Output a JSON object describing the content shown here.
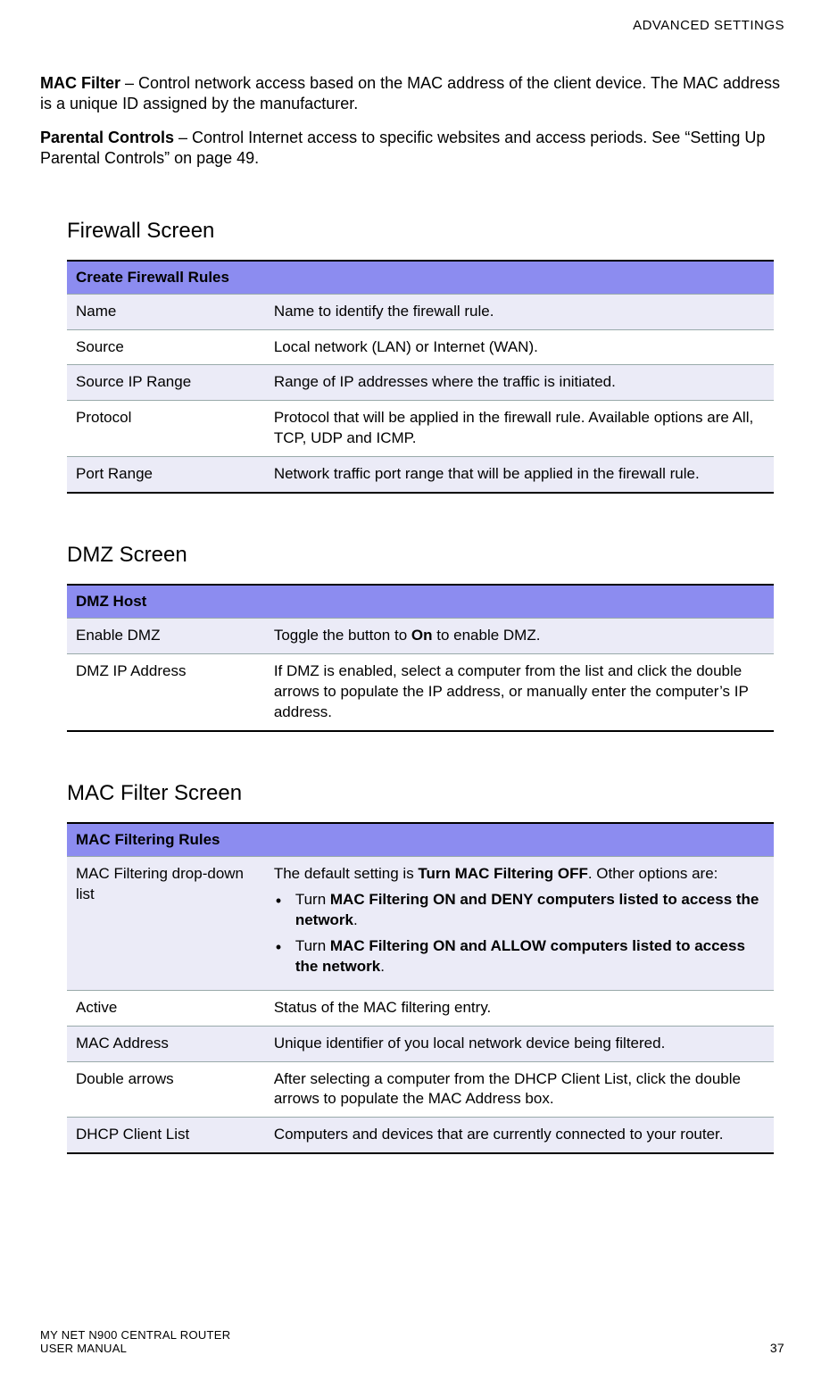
{
  "header": {
    "section": "ADVANCED SETTINGS"
  },
  "intro": {
    "macFilter": {
      "term": "MAC Filter",
      "desc": " – Control network access based on the MAC address of the client device. The MAC address is a unique ID assigned by the manufacturer."
    },
    "parental": {
      "term": "Parental Controls",
      "desc": " – Control Internet access to specific websites and access periods. See “Setting Up Parental Controls” on page 49."
    }
  },
  "firewall": {
    "title": "Firewall Screen",
    "tableHeader": "Create Firewall Rules",
    "rows": [
      {
        "label": "Name",
        "desc": "Name to identify the firewall rule."
      },
      {
        "label": "Source",
        "desc": "Local network (LAN) or Internet (WAN)."
      },
      {
        "label": "Source IP Range",
        "desc": "Range of IP addresses where the traffic is initiated."
      },
      {
        "label": "Protocol",
        "desc": "Protocol that will be applied in the firewall rule. Available options are All, TCP, UDP and ICMP."
      },
      {
        "label": "Port Range",
        "desc": "Network traffic port range that will be applied in the firewall rule."
      }
    ]
  },
  "dmz": {
    "title": "DMZ Screen",
    "tableHeader": "DMZ Host",
    "rows": [
      {
        "label": "Enable DMZ",
        "pre": "Toggle the button to ",
        "bold": "On",
        "post": " to enable DMZ."
      },
      {
        "label": "DMZ IP Address",
        "desc": "If DMZ is enabled, select a computer from the list and click the double arrows to populate the IP address, or manually enter the computer’s IP address."
      }
    ]
  },
  "mac": {
    "title": "MAC Filter Screen",
    "tableHeader": "MAC Filtering Rules",
    "row0": {
      "label": "MAC Filtering drop-down list",
      "pre": "The default setting is ",
      "boldDefault": "Turn MAC Filtering OFF",
      "post": ". Other options are:",
      "opt1_pre": "Turn ",
      "opt1_bold": "MAC Filtering ON and DENY computers listed to access the network",
      "opt1_post": ".",
      "opt2_pre": "Turn ",
      "opt2_bold": "MAC Filtering ON and ALLOW computers listed to access the network",
      "opt2_post": "."
    },
    "rows": [
      {
        "label": "Active",
        "desc": "Status of the MAC filtering entry."
      },
      {
        "label": "MAC Address",
        "desc": "Unique identifier of you local network device being filtered."
      },
      {
        "label": "Double arrows",
        "desc": "After selecting a computer from the DHCP Client List, click the double arrows to populate the MAC Address box."
      },
      {
        "label": "DHCP Client List",
        "desc": "Computers and devices that are currently connected to your router."
      }
    ]
  },
  "footer": {
    "line1": "MY NET N900 CENTRAL ROUTER",
    "line2": "USER MANUAL",
    "page": "37"
  }
}
